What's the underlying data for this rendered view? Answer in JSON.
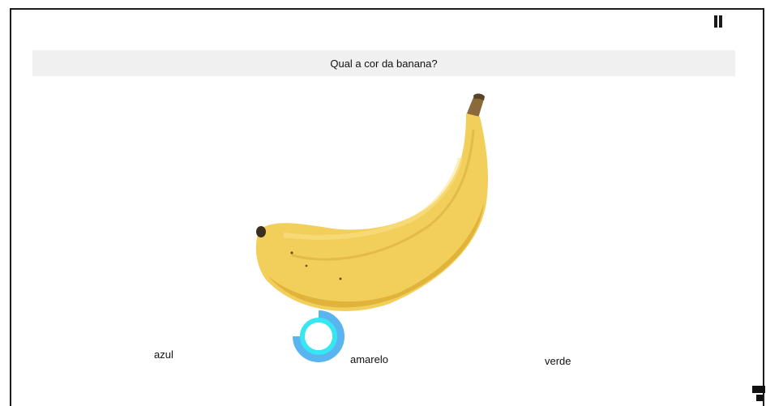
{
  "quiz": {
    "question": "Qual a cor da banana?",
    "answers": [
      "azul",
      "amarelo",
      "verde"
    ],
    "image_subject": "banana",
    "selection_progress": 0.75
  },
  "colors": {
    "frame": "#1c1c1c",
    "question_bar_bg": "#f0f0f0",
    "ring_outer": "#5ab4f0",
    "ring_inner": "#36e6f2",
    "banana_body": "#f2cf5b",
    "banana_shadow": "#d9a92f",
    "banana_stem": "#8a6a3a"
  },
  "icons": {
    "pause": "pause-icon",
    "selection": "gaze-progress-ring-icon",
    "corner": "layout-toggle-icon"
  }
}
